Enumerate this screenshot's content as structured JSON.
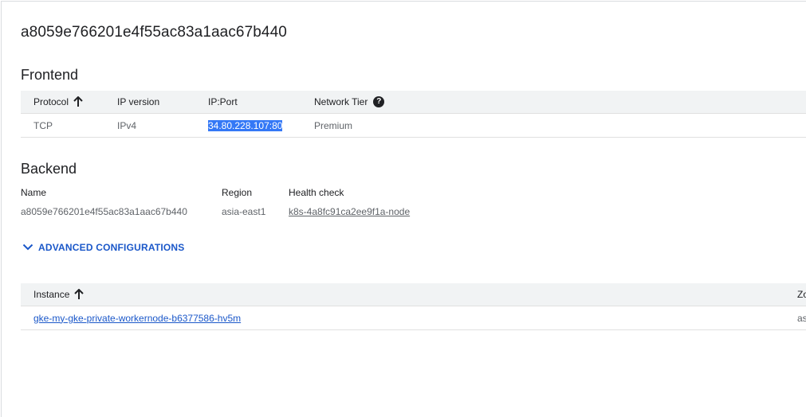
{
  "header": {
    "lb_name": "a8059e766201e4f55ac83a1aac67b440"
  },
  "frontend": {
    "title": "Frontend",
    "columns": {
      "protocol": "Protocol",
      "ip_version": "IP version",
      "ip_port": "IP:Port",
      "network_tier": "Network Tier"
    },
    "help_glyph": "?",
    "rows": [
      {
        "protocol": "TCP",
        "ip_version": "IPv4",
        "ip_port": "34.80.228.107:80",
        "network_tier": "Premium"
      }
    ]
  },
  "backend": {
    "title": "Backend",
    "headers": {
      "name": "Name",
      "region": "Region",
      "health_check": "Health check"
    },
    "values": {
      "name": "a8059e766201e4f55ac83a1aac67b440",
      "region": "asia-east1",
      "health_check": "k8s-4a8fc91ca2ee9f1a-node"
    }
  },
  "advanced": {
    "label": "ADVANCED CONFIGURATIONS"
  },
  "instances": {
    "columns": {
      "instance": "Instance",
      "zone_partial": "Zo"
    },
    "rows": [
      {
        "instance": "gke-my-gke-private-workernode-b6377586-hv5m",
        "zone_partial": "as"
      }
    ]
  },
  "colors": {
    "link": "#1a57c9",
    "header_bg": "#f1f3f4",
    "selection": "#3478f6"
  },
  "icons": {
    "sort": "arrow-up-icon",
    "help": "help-circle-icon",
    "expand": "chevron-down-icon"
  }
}
